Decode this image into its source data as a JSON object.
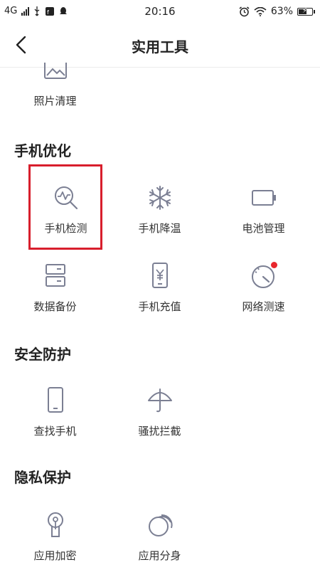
{
  "status_bar": {
    "network": "4G",
    "time": "20:16",
    "battery": "63%",
    "battery_level": 0.63
  },
  "header": {
    "title": "实用工具"
  },
  "top_partial": {
    "label": "照片清理",
    "icon": "photo-icon"
  },
  "sections": [
    {
      "title": "手机优化",
      "items": [
        {
          "label": "手机检测",
          "icon": "phone-check-icon"
        },
        {
          "label": "手机降温",
          "icon": "snowflake-icon"
        },
        {
          "label": "电池管理",
          "icon": "battery-icon"
        },
        {
          "label": "数据备份",
          "icon": "backup-icon"
        },
        {
          "label": "手机充值",
          "icon": "recharge-icon"
        },
        {
          "label": "网络测速",
          "icon": "speedometer-icon",
          "badge": true
        }
      ]
    },
    {
      "title": "安全防护",
      "items": [
        {
          "label": "查找手机",
          "icon": "find-phone-icon"
        },
        {
          "label": "骚扰拦截",
          "icon": "umbrella-icon"
        }
      ]
    },
    {
      "title": "隐私保护",
      "items": [
        {
          "label": "应用加密",
          "icon": "keyhole-icon"
        },
        {
          "label": "应用分身",
          "icon": "app-clone-icon"
        }
      ]
    }
  ],
  "colors": {
    "icon_stroke": "#7b7f93",
    "badge": "#e8262d",
    "highlight": "#d81e2c"
  }
}
